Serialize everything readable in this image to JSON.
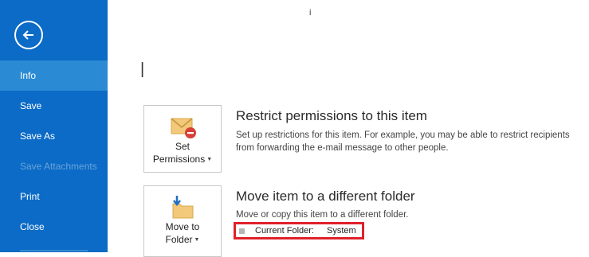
{
  "sidebar": {
    "back_icon": "back-arrow-icon",
    "items": [
      {
        "label": "Info",
        "active": true,
        "enabled": true
      },
      {
        "label": "Save",
        "active": false,
        "enabled": true
      },
      {
        "label": "Save As",
        "active": false,
        "enabled": true
      },
      {
        "label": "Save Attachments",
        "active": false,
        "enabled": false
      },
      {
        "label": "Print",
        "active": false,
        "enabled": true
      },
      {
        "label": "Close",
        "active": false,
        "enabled": true
      }
    ]
  },
  "main": {
    "top_glyph": "i",
    "cursor_glyph": "|",
    "restrict": {
      "button_line1": "Set",
      "button_line2": "Permissions",
      "icon": "envelope-restrict-icon",
      "title": "Restrict permissions to this item",
      "description": "Set up restrictions for this item. For example, you may be able to restrict recipients from forwarding the e-mail message to other people."
    },
    "move": {
      "button_line1": "Move to",
      "button_line2": "Folder",
      "icon": "move-folder-icon",
      "title": "Move item to a different folder",
      "description": "Move or copy this item to a different folder.",
      "current_folder_label": "Current Folder:",
      "current_folder_value": "System"
    }
  },
  "colors": {
    "sidebar_bg": "#0b6bc6",
    "sidebar_active": "#2a8ad4",
    "highlight_border": "#e0202a"
  }
}
